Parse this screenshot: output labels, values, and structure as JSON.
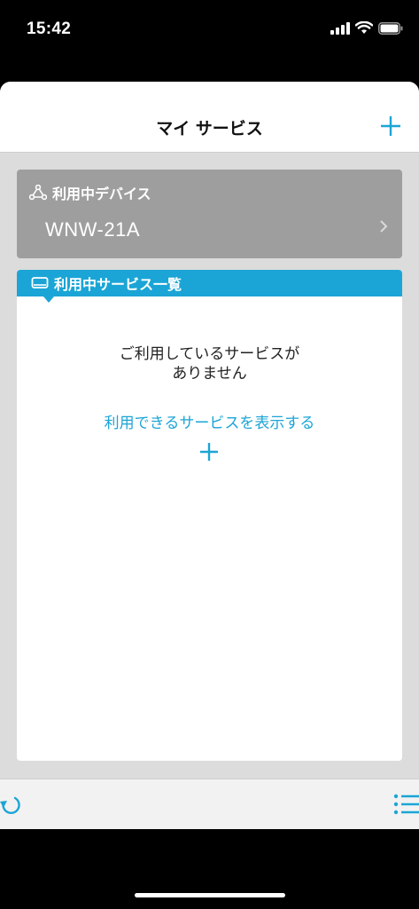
{
  "status_bar": {
    "time": "15:42"
  },
  "nav": {
    "title": "マイ サービス"
  },
  "device_card": {
    "header": "利用中デバイス",
    "device_name": "WNW-21A"
  },
  "services_card": {
    "header": "利用中サービス一覧",
    "empty_line1": "ご利用しているサービスが",
    "empty_line2": "ありません",
    "show_services_link": "利用できるサービスを表示する"
  },
  "colors": {
    "accent": "#1ba5d6",
    "device_card_bg": "#9e9e9e",
    "background": "#dcdcdc"
  },
  "icons": {
    "add": "plus-icon",
    "device": "network-triangle-icon",
    "chevron": "chevron-right-icon",
    "services": "display-icon",
    "refresh": "refresh-icon",
    "menu": "list-icon"
  }
}
